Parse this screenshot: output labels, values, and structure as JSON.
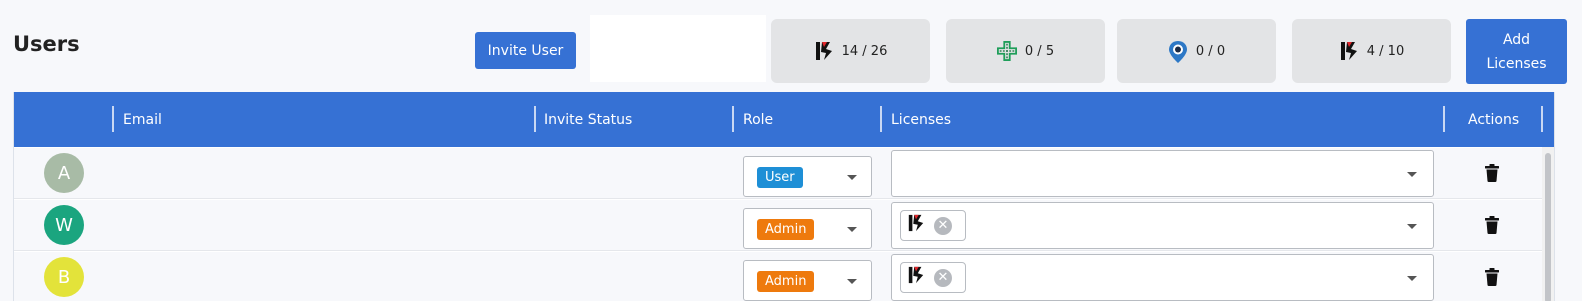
{
  "page": {
    "title": "Users"
  },
  "header": {
    "invite_label": "Invite User",
    "add_licenses_label": "Add\nLicenses",
    "license_counts": [
      {
        "icon": "hs-logo-icon",
        "text": "14 / 26"
      },
      {
        "icon": "green-cross-icon",
        "text": "0 / 5"
      },
      {
        "icon": "map-pin-icon",
        "text": "0 / 0"
      },
      {
        "icon": "hs-logo-icon",
        "text": "4 / 10"
      }
    ]
  },
  "table": {
    "columns": [
      "Email",
      "Invite Status",
      "Role",
      "Licenses",
      "Actions"
    ],
    "rows": [
      {
        "avatar_letter": "A",
        "avatar_color": "#a8bba6",
        "role": "User",
        "role_color": "#1e8fd6",
        "licenses": []
      },
      {
        "avatar_letter": "W",
        "avatar_color": "#1ba57f",
        "role": "Admin",
        "role_color": "#ee7a0d",
        "licenses": [
          "hs-logo-icon"
        ]
      },
      {
        "avatar_letter": "B",
        "avatar_color": "#e3e33a",
        "role": "Admin",
        "role_color": "#ee7a0d",
        "licenses": [
          "hs-logo-icon"
        ]
      }
    ]
  },
  "colors": {
    "accent": "#3671d4"
  }
}
